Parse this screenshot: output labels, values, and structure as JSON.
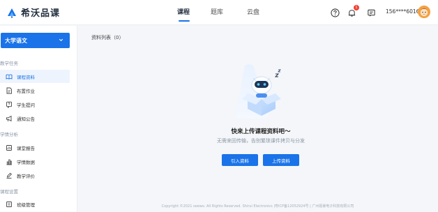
{
  "brand": {
    "name": "希沃品课",
    "accent": "#1a73e8"
  },
  "nav": {
    "tabs": [
      {
        "label": "课程",
        "active": true
      },
      {
        "label": "题库",
        "active": false
      },
      {
        "label": "云盘",
        "active": false
      }
    ]
  },
  "header": {
    "icons": [
      "help-icon",
      "bell-icon",
      "message-icon"
    ],
    "notification_count": "1",
    "user_phone": "156****6016"
  },
  "sidebar": {
    "course": "大学语文",
    "sections": [
      {
        "title": "教学任务",
        "items": [
          {
            "label": "课程资料",
            "icon": "book-open-icon",
            "active": true
          },
          {
            "label": "布置作业",
            "icon": "document-icon",
            "active": false
          },
          {
            "label": "学生提问",
            "icon": "question-chat-icon",
            "active": false
          },
          {
            "label": "通知公告",
            "icon": "megaphone-icon",
            "active": false
          }
        ]
      },
      {
        "title": "学情分析",
        "items": [
          {
            "label": "课堂报告",
            "icon": "report-icon",
            "active": false
          },
          {
            "label": "学情数据",
            "icon": "bar-chart-icon",
            "active": false
          },
          {
            "label": "教学评价",
            "icon": "edit-icon",
            "active": false
          }
        ]
      },
      {
        "title": "课程设置",
        "items": [
          {
            "label": "班级管理",
            "icon": "class-icon",
            "active": false
          }
        ]
      }
    ]
  },
  "main": {
    "list_title": "资料列表（0）",
    "empty_title": "快来上传课程资料吧～",
    "empty_desc": "无需来回传输，告别繁琐课件拷贝与分发",
    "import_button": "引入资料",
    "upload_button": "上传资料"
  },
  "footer": "Copyright ©2021 seewo. All Rights Reserved. Shirui Electronics |粤ICP备12052924号 | 广州视睿电子科技有限公司"
}
